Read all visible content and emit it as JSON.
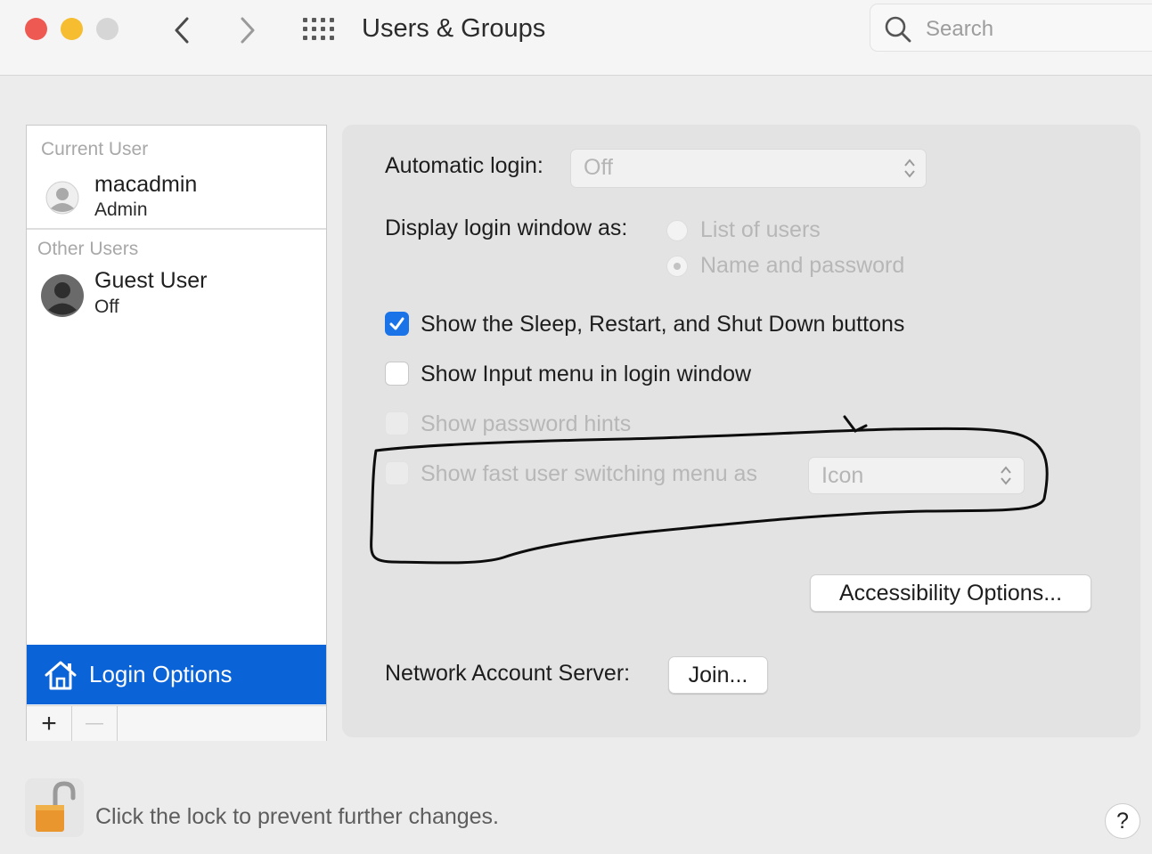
{
  "window": {
    "title": "Users & Groups",
    "search_placeholder": "Search"
  },
  "sidebar": {
    "current_user_label": "Current User",
    "current_user": {
      "name": "macadmin",
      "role": "Admin"
    },
    "other_users_label": "Other Users",
    "other_users": [
      {
        "name": "Guest User",
        "status": "Off"
      }
    ],
    "login_options_label": "Login Options",
    "add_label": "+",
    "remove_label": "—"
  },
  "login_options": {
    "automatic_login_label": "Automatic login:",
    "automatic_login_value": "Off",
    "display_login_window_label": "Display login window as:",
    "display_options": [
      {
        "label": "List of users",
        "selected": false
      },
      {
        "label": "Name and password",
        "selected": true
      }
    ],
    "show_sleep_restart_label": "Show the Sleep, Restart, and Shut Down buttons",
    "show_sleep_restart_checked": true,
    "show_input_menu_label": "Show Input menu in login window",
    "show_input_menu_checked": false,
    "show_password_hints_label": "Show password hints",
    "show_password_hints_checked": false,
    "fast_user_switching_label": "Show fast user switching menu as",
    "fast_user_switching_checked": false,
    "fast_user_switching_value": "Icon",
    "accessibility_button": "Accessibility Options...",
    "network_account_server_label": "Network Account Server:",
    "join_button": "Join..."
  },
  "footer": {
    "lock_text": "Click the lock to prevent further changes.",
    "help_label": "?"
  },
  "colors": {
    "accent": "#0b63d8",
    "checkbox_checked": "#1b73e8",
    "close": "#ee5a52",
    "minimize": "#f5bd2f",
    "annotation_stroke": "#000000"
  }
}
